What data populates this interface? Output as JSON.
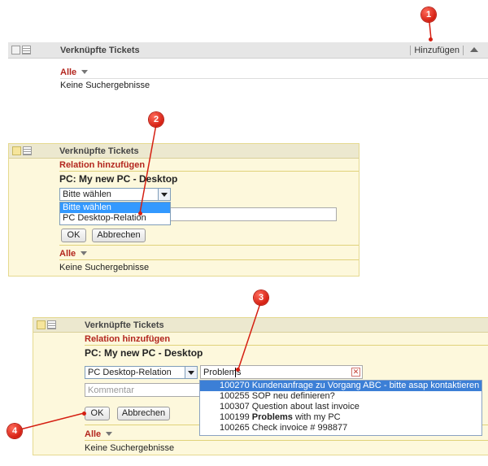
{
  "panel1": {
    "title": "Verknüpfte Tickets",
    "add_link": "Hinzufügen",
    "filter": "Alle",
    "empty": "Keine Suchergebnisse"
  },
  "panel2": {
    "title": "Verknüpfte Tickets",
    "section": "Relation hinzufügen",
    "object": "PC: My new PC - Desktop",
    "select_value": "Bitte wählen",
    "options": [
      "Bitte wählen",
      "PC Desktop-Relation"
    ],
    "ok": "OK",
    "cancel": "Abbrechen",
    "filter": "Alle",
    "empty": "Keine Suchergebnisse"
  },
  "panel3": {
    "title": "Verknüpfte Tickets",
    "section": "Relation hinzufügen",
    "object": "PC: My new PC - Desktop",
    "select_value": "PC Desktop-Relation",
    "search_value": "Problems",
    "comment_placeholder": "Kommentar",
    "ok": "OK",
    "cancel": "Abbrechen",
    "filter": "Alle",
    "empty": "Keine Suchergebnisse",
    "results": [
      {
        "id": "100270",
        "text": "Kundenanfrage zu Vorgang ABC - bitte asap kontaktieren"
      },
      {
        "id": "100255",
        "text": "SOP neu definieren?"
      },
      {
        "id": "100307",
        "text": "Question about last invoice"
      },
      {
        "id": "100199",
        "pre": "",
        "bold": "Problems",
        "post": " with my PC"
      },
      {
        "id": "100265",
        "text": "Check invoice # 998877"
      }
    ]
  },
  "markers": [
    "1",
    "2",
    "3",
    "4"
  ],
  "colors": {
    "marker": "#d51f12",
    "accent_text": "#b3261e",
    "highlight": "#3399ff",
    "panel_bg": "#fdf8dc"
  }
}
